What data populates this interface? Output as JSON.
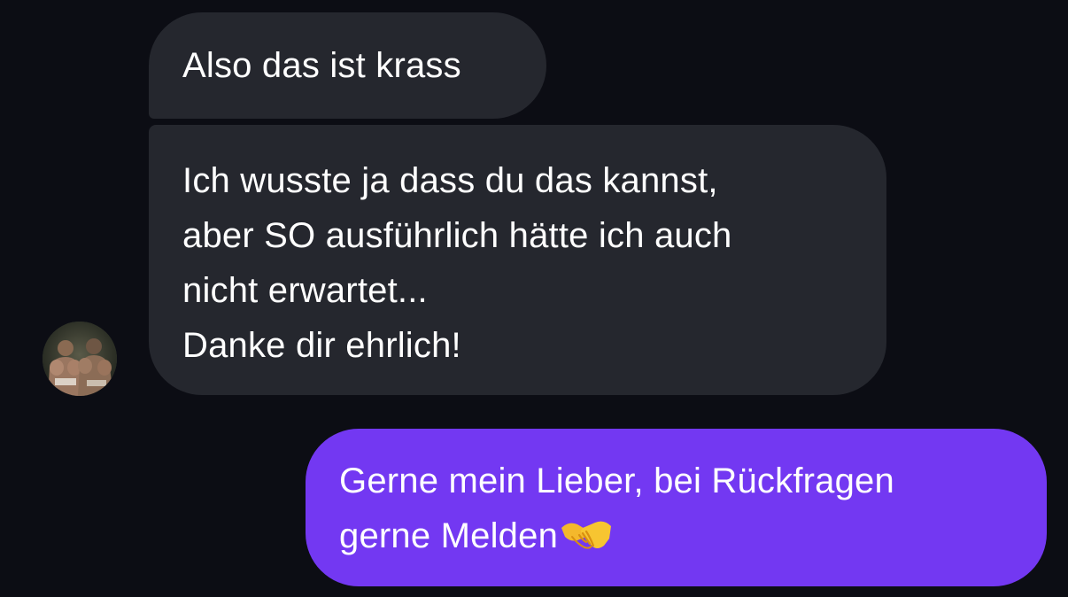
{
  "conversation": {
    "messages": [
      {
        "direction": "incoming",
        "lines": [
          "Also das ist krass"
        ]
      },
      {
        "direction": "incoming",
        "lines": [
          "Ich wusste ja dass du das kannst,",
          "aber SO ausführlich hätte ich auch",
          "nicht erwartet...",
          "Danke dir ehrlich!"
        ]
      },
      {
        "direction": "outgoing",
        "lines": [
          "Gerne mein Lieber, bei Rückfragen",
          "gerne Melden"
        ],
        "emoji": "handshake-icon"
      }
    ],
    "sender_avatar": "avatar-photo-two-bodybuilders"
  },
  "colors": {
    "background": "#0c0d14",
    "incoming_bubble": "#25272e",
    "outgoing_bubble": "#7338f2",
    "text": "#ffffff"
  }
}
